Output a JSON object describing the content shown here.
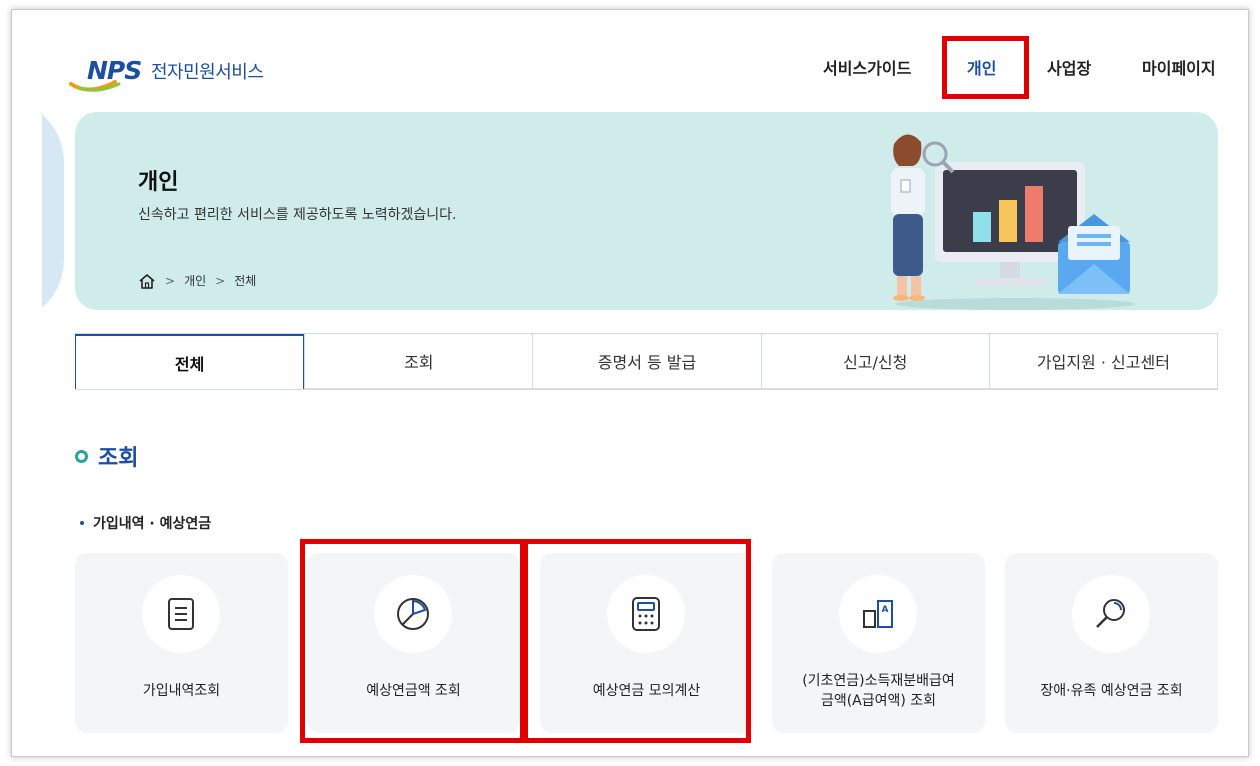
{
  "header": {
    "logo_mark": "NPS",
    "logo_text": "전자민원서비스",
    "nav": [
      {
        "label": "서비스가이드",
        "active": false
      },
      {
        "label": "개인",
        "active": true
      },
      {
        "label": "사업장",
        "active": false
      },
      {
        "label": "마이페이지",
        "active": false
      }
    ]
  },
  "banner": {
    "title": "개인",
    "subtitle": "신속하고 편리한 서비스를 제공하도록 노력하겠습니다.",
    "breadcrumb": [
      "개인",
      "전체"
    ],
    "home_icon": "home-icon"
  },
  "tabs": [
    {
      "label": "전체",
      "active": true
    },
    {
      "label": "조회",
      "active": false
    },
    {
      "label": "증명서 등 발급",
      "active": false
    },
    {
      "label": "신고/신청",
      "active": false
    },
    {
      "label": "가입지원 · 신고센터",
      "active": false
    }
  ],
  "section": {
    "title": "조회",
    "subheading": "가입내역 · 예상연금",
    "cards": [
      {
        "label": "가입내역조회",
        "icon": "document-list-icon"
      },
      {
        "label": "예상연금액 조회",
        "icon": "pie-chart-icon"
      },
      {
        "label": "예상연금 모의계산",
        "icon": "calculator-icon"
      },
      {
        "label_line1": "(기초연금)소득재분배급여",
        "label_line2": "금액(A급여액) 조회",
        "icon": "document-a-icon"
      },
      {
        "label": "장애·유족 예상연금 조회",
        "icon": "magnifier-icon"
      }
    ]
  },
  "colors": {
    "brand_blue": "#1c4fa1",
    "banner_bg": "#cfeceb",
    "highlight_red": "#e00000",
    "card_bg": "#f4f5f7",
    "accent_teal": "#2aa39c"
  }
}
